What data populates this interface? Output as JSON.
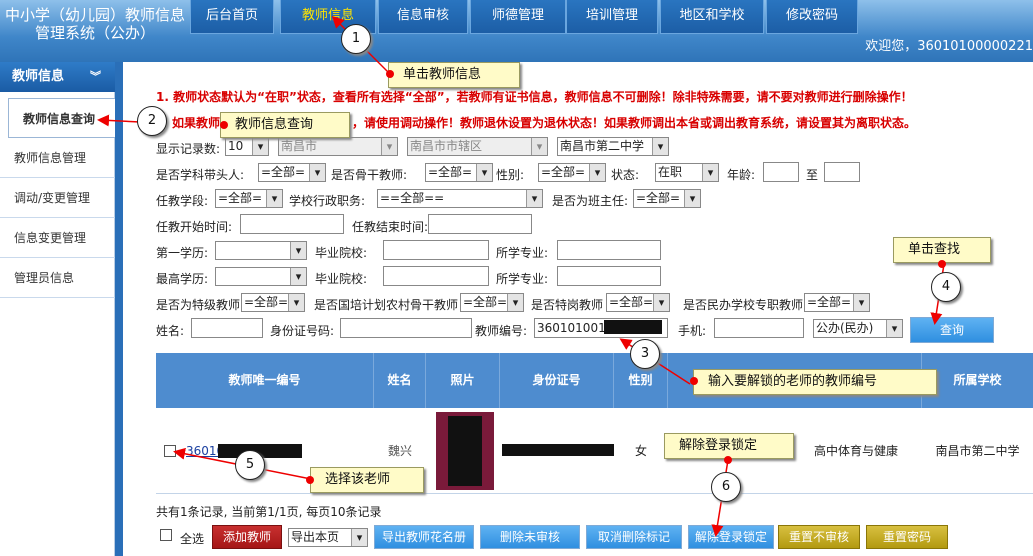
{
  "header": {
    "system_name": "中小学（幼儿园）教师信息管理系统（公办）",
    "welcome": "欢迎您，36010100000221"
  },
  "tabs": [
    {
      "label": "后台首页"
    },
    {
      "label": "教师信息"
    },
    {
      "label": "信息审核"
    },
    {
      "label": "师德管理"
    },
    {
      "label": "培训管理"
    },
    {
      "label": "地区和学校"
    },
    {
      "label": "修改密码"
    }
  ],
  "sidebar": {
    "title": "教师信息",
    "items": [
      {
        "label": "教师信息查询"
      },
      {
        "label": "教师信息管理"
      },
      {
        "label": "调动/变更管理"
      },
      {
        "label": "信息变更管理"
      },
      {
        "label": "管理员信息"
      }
    ]
  },
  "notice": {
    "line1": "1. 教师状态默认为“在职”状态，查看所有选择“全部”，若教师有证书信息，教师信息不可删除！除非特殊需要，请不要对教师进行删除操作！",
    "line2_a": "如果教师",
    "line2_b": "，请使用调动操作！教师退休设置为退休状态！如果教师调出本省或调出教育系统，请设置其为离职状态。"
  },
  "form": {
    "page_size_label": "显示记录数:",
    "page_size": "10",
    "city": "南昌市",
    "district": "南昌市市辖区",
    "school": "南昌市第二中学",
    "leader_label": "是否学科带头人:",
    "leader": "=全部=",
    "backbone_label": "是否骨干教师:",
    "backbone": "=全部=",
    "gender_label": "性别:",
    "gender": "=全部=",
    "status_label": "状态:",
    "status": "在职",
    "age_label": "年龄:",
    "age_to": "至",
    "stage_label": "任教学段:",
    "stage": "=全部=",
    "admin_post_label": "学校行政职务:",
    "admin_post": "==全部==",
    "head_teacher_label": "是否为班主任:",
    "head_teacher": "=全部=",
    "start_label": "任教开始时间:",
    "end_label": "任教结束时间:",
    "first_edu_label": "第一学历:",
    "grad_school_label": "毕业院校:",
    "major_label": "所学专业:",
    "top_edu_label": "最高学历:",
    "grad_school2_label": "毕业院校:",
    "major2_label": "所学专业:",
    "special_label": "是否为特级教师",
    "special": "=全部=",
    "rural_label": "是否国培计划农村骨干教师",
    "rural": "=全部=",
    "post_label": "是否特岗教师",
    "post": "=全部=",
    "private_label": "是否民办学校专职教师",
    "private": "=全部=",
    "name_label": "姓名:",
    "id_label": "身份证号码:",
    "teacher_no_label": "教师编号:",
    "teacher_no": "360101001",
    "phone_label": "手机:",
    "school_type": "公办(民办)",
    "search_btn": "查询"
  },
  "table": {
    "headers": [
      "教师唯一编号",
      "姓名",
      "照片",
      "身份证号",
      "性别",
      "所属学校"
    ],
    "row": {
      "id": "36010",
      "name": "魏兴",
      "gender": "女",
      "subject": "高中体育与健康",
      "school": "南昌市第二中学"
    }
  },
  "pager": "共有1条记录, 当前第1/1页, 每页10条记录",
  "actions": {
    "select_all": "全选",
    "add": "添加教师",
    "export_select": "导出本页",
    "export_roster": "导出教师花名册",
    "del_unaudited": "删除未审核",
    "cancel_del": "取消删除标记",
    "unlock": "解除登录锁定",
    "reset_unaudited": "重置不审核",
    "reset_pwd": "重置密码"
  },
  "callouts": {
    "c1": "单击教师信息",
    "c2": "教师信息查询",
    "c3": "输入要解锁的老师的教师编号",
    "c4": "单击查找",
    "c5": "选择该老师",
    "c6": "解除登录锁定"
  },
  "steps": [
    "1",
    "2",
    "3",
    "4",
    "5",
    "6"
  ]
}
